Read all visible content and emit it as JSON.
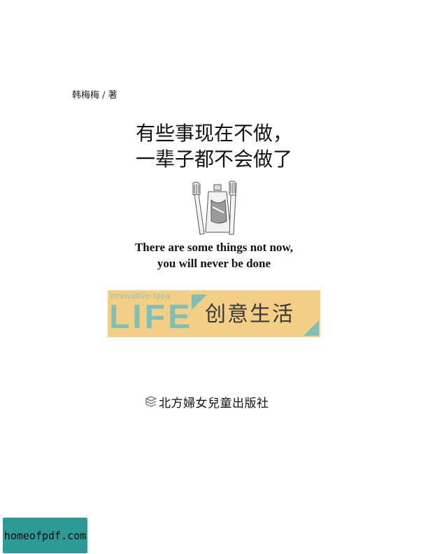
{
  "author": "韩梅梅 / 著",
  "title": {
    "line1": "有些事现在不做，",
    "line2": "一辈子都不会做了"
  },
  "illustration": {
    "icon": "toothbrush-and-toothpaste-icon"
  },
  "subtitle": {
    "line1": "There are some things not now,",
    "line2": "you will never be done"
  },
  "banner": {
    "tagline": "Innovative Idea",
    "word": "LIFE",
    "series_name": "创意生活",
    "background_color": "#f3cf85",
    "accent_color": "#7ec0b8"
  },
  "publisher": {
    "name": "北方婦女兒童出版社",
    "logo_icon": "publisher-logo-icon"
  },
  "watermark": {
    "text": "homeofpdf.com",
    "color": "#2d9a95"
  }
}
